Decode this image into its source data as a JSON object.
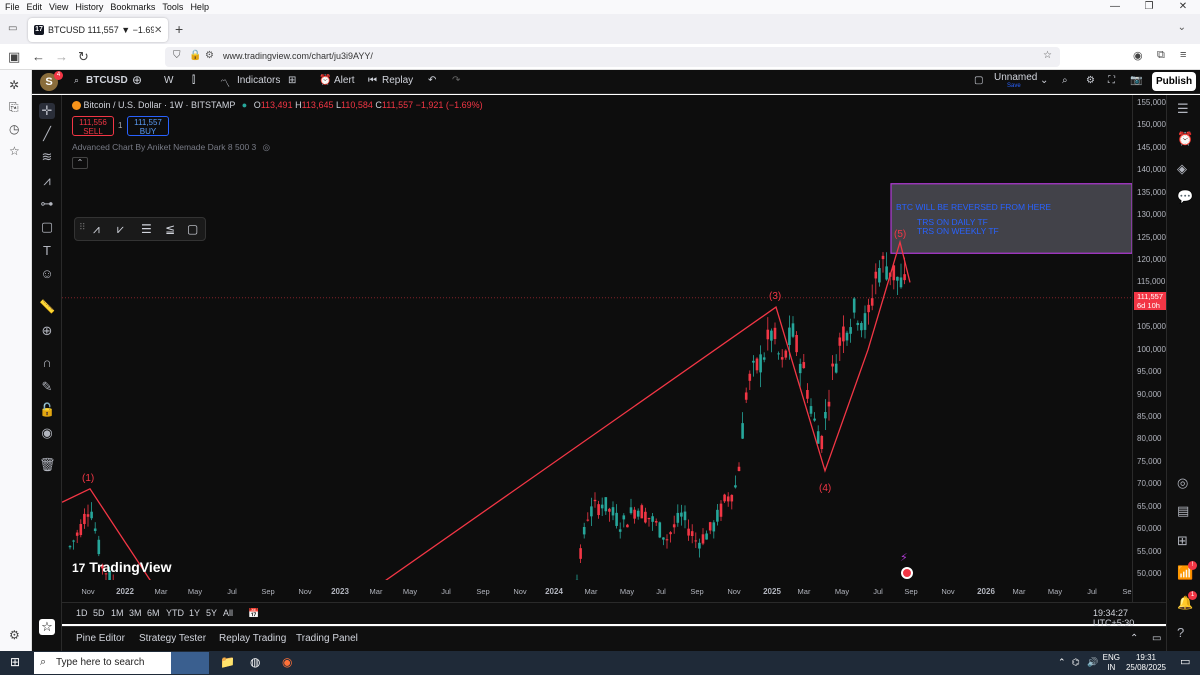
{
  "menubar": {
    "items": [
      "File",
      "Edit",
      "View",
      "History",
      "Bookmarks",
      "Tools",
      "Help"
    ]
  },
  "browser": {
    "tab_title": "BTCUSD 111,557 ▼ −1.69% Un",
    "url": "www.tradingview.com/chart/ju3i9AYY/"
  },
  "tv_top": {
    "avatar_letter": "S",
    "avatar_badge": "4",
    "symbol": "BTCUSD",
    "interval": "W",
    "indicators": "Indicators",
    "alert": "Alert",
    "replay": "Replay",
    "layout_name": "Unnamed",
    "save": "Save",
    "publish": "Publish"
  },
  "legend": {
    "title": "Bitcoin / U.S. Dollar · 1W · BITSTAMP",
    "o_label": "O",
    "o": "113,491",
    "h_label": "H",
    "h": "113,645",
    "l_label": "L",
    "l": "110,584",
    "c_label": "C",
    "c": "111,557",
    "change": "−1,921 (−1.69%)",
    "sell_price": "111,556",
    "sell_label": "SELL",
    "spread": "1",
    "buy_price": "111,557",
    "buy_label": "BUY",
    "indicator_line": "Advanced Chart By Aniket Nemade Dark 8 500 3"
  },
  "annotations": {
    "box_line1": "BTC WILL BE REVERSED FROM HERE",
    "box_line2": "TRS ON DAILY TF",
    "box_line3": "TRS ON WEEKLY TF",
    "wave1": "(1)",
    "wave3": "(3)",
    "wave4": "(4)",
    "wave5": "(5)"
  },
  "watermark": "TradingView",
  "price_axis": {
    "labels": [
      "155,000",
      "150,000",
      "145,000",
      "140,000",
      "135,000",
      "130,000",
      "125,000",
      "120,000",
      "115,000",
      "110,000",
      "105,000",
      "100,000",
      "95,000",
      "90,000",
      "85,000",
      "80,000",
      "75,000",
      "70,000",
      "65,000",
      "60,000",
      "55,000",
      "50,000"
    ],
    "current_price": "111,557",
    "countdown": "6d 10h"
  },
  "time_axis": {
    "labels": [
      "Nov",
      "2022",
      "Mar",
      "May",
      "Jul",
      "Sep",
      "Nov",
      "2023",
      "Mar",
      "May",
      "Jul",
      "Sep",
      "Nov",
      "2024",
      "Mar",
      "May",
      "Jul",
      "Sep",
      "Nov",
      "2025",
      "Mar",
      "May",
      "Jul",
      "Sep",
      "Nov",
      "2026",
      "Mar",
      "May",
      "Jul",
      "Se"
    ]
  },
  "range_bar": {
    "ranges": [
      "1D",
      "5D",
      "1M",
      "3M",
      "6M",
      "YTD",
      "1Y",
      "5Y",
      "All"
    ],
    "clock": "19:34:27 UTC+5:30"
  },
  "bottom_tabs": [
    "Pine Editor",
    "Strategy Tester",
    "Replay Trading",
    "Trading Panel"
  ],
  "taskbar": {
    "search_placeholder": "Type here to search",
    "lang1": "ENG",
    "lang2": "IN",
    "time": "19:31",
    "date": "25/08/2025"
  },
  "colors": {
    "bull": "#26a69a",
    "bear": "#f23645",
    "box_fill": "#5a5a64",
    "box_border": "#b13bd6",
    "box_text": "#2962ff"
  },
  "chart_data": {
    "type": "candlestick",
    "ylim": [
      48000,
      157000
    ],
    "ticks": [
      50000,
      55000,
      60000,
      65000,
      70000,
      75000,
      80000,
      85000,
      90000,
      95000,
      100000,
      105000,
      110000,
      115000,
      120000,
      125000,
      130000,
      135000,
      140000,
      145000,
      150000,
      155000
    ],
    "current": 111557,
    "annotation_box": {
      "y_low": 121500,
      "y_high": 137000
    },
    "wave_points": [
      {
        "label": "(1)",
        "y": 69000
      },
      {
        "label": "(3)",
        "y": 109500
      },
      {
        "label": "(4)",
        "y": 73000
      },
      {
        "label": "(5)",
        "y": 124000
      }
    ]
  }
}
